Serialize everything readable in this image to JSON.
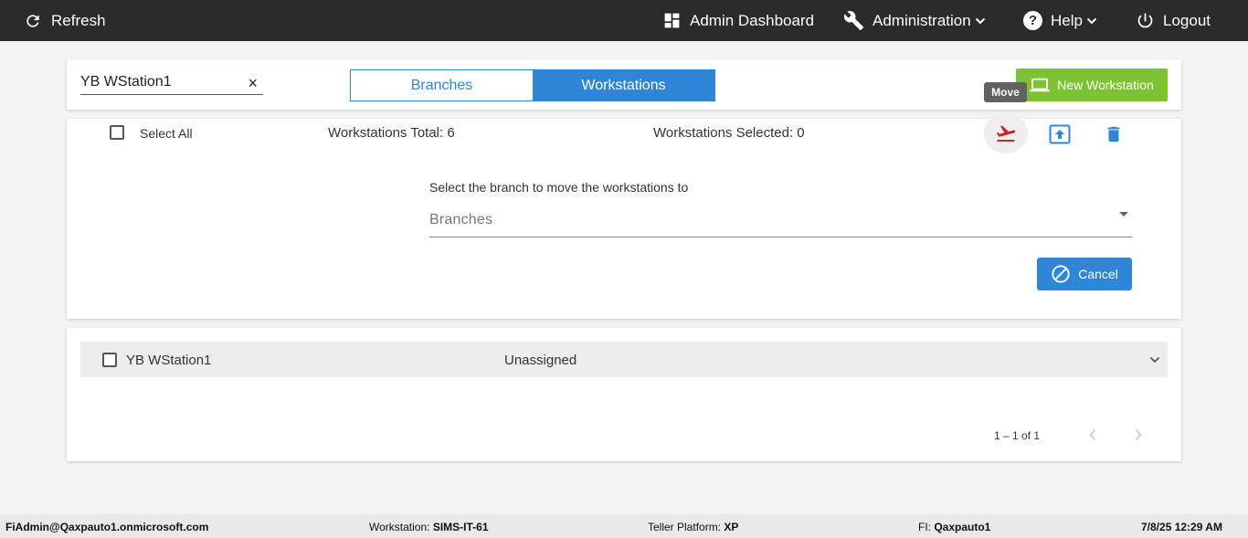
{
  "topbar": {
    "refresh_label": "Refresh",
    "admin_dashboard_label": "Admin Dashboard",
    "administration_label": "Administration",
    "help_label": "Help",
    "help_icon_glyph": "?",
    "logout_label": "Logout"
  },
  "search": {
    "value": "YB WStation1",
    "clear_glyph": "×"
  },
  "tabs": {
    "branches_label": "Branches",
    "workstations_label": "Workstations",
    "active": "Workstations"
  },
  "new_workstation_label": "New Workstation",
  "tooltip_label": "Move",
  "toolbar": {
    "select_all_label": "Select All",
    "total_label": "Workstations Total: 6",
    "selected_label": "Workstations Selected: 0"
  },
  "move_panel": {
    "instruction": "Select the branch to move the workstations to",
    "branch_placeholder": "Branches",
    "cancel_label": "Cancel"
  },
  "workstations": [
    {
      "name": "YB WStation1",
      "branch": "Unassigned"
    }
  ],
  "pager": {
    "range_label": "1 – 1 of 1"
  },
  "footer": {
    "user": "FiAdmin@Qaxpauto1.onmicrosoft.com",
    "workstation_label": "Workstation:",
    "workstation_value": "SIMS-IT-61",
    "platform_label": "Teller Platform:",
    "platform_value": "XP",
    "fi_label": "FI:",
    "fi_value": "Qaxpauto1",
    "datetime": "7/8/25 12:29 AM"
  },
  "colors": {
    "topbar": "#2b2b2b",
    "primary": "#2f86d6",
    "success": "#7cc231",
    "move_icon": "#c62828"
  }
}
